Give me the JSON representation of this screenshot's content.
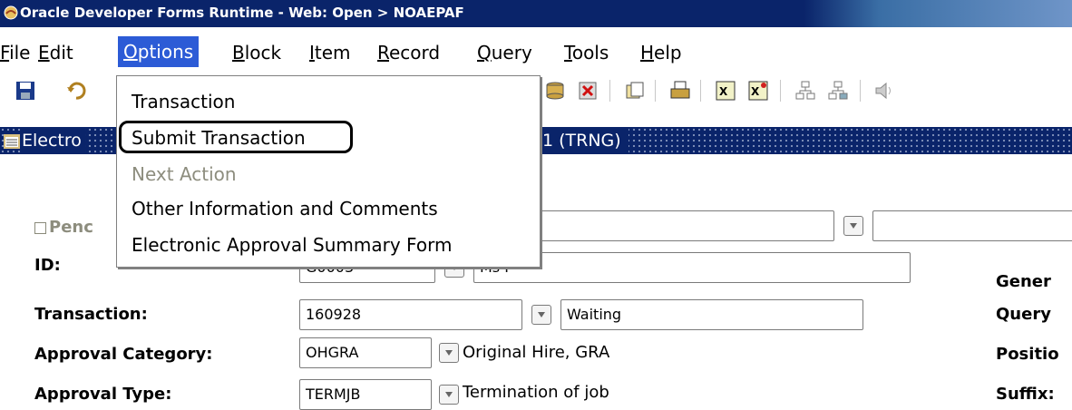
{
  "window": {
    "title": "Oracle Developer Forms Runtime - Web:  Open > NOAEPAF"
  },
  "menubar": {
    "items": [
      {
        "label": "File"
      },
      {
        "label": "Edit"
      },
      {
        "label": "Options"
      },
      {
        "label": "Block"
      },
      {
        "label": "Item"
      },
      {
        "label": "Record"
      },
      {
        "label": "Query"
      },
      {
        "label": "Tools"
      },
      {
        "label": "Help"
      }
    ],
    "active": "Options"
  },
  "options_menu": {
    "items": [
      {
        "label": "Transaction",
        "enabled": true
      },
      {
        "label": "Submit Transaction",
        "enabled": true,
        "highlighted": true
      },
      {
        "label": "Next Action",
        "enabled": false
      },
      {
        "label": "Other Information and Comments",
        "enabled": true
      },
      {
        "label": "Electronic Approval Summary Form",
        "enabled": true
      }
    ]
  },
  "toolbar": {
    "icons": [
      "save-icon",
      "rollback-icon",
      "database-icon",
      "delete-record-icon",
      "print-icon",
      "printer-icon",
      "exit-icon",
      "excel-icon",
      "chart-icon",
      "hierarchy-icon",
      "hierarchy-alt-icon",
      "speaker-icon"
    ]
  },
  "form": {
    "title_left": "Electro",
    "title_right": "1 (TRNG)",
    "pending_label": "Penc",
    "fields": {
      "id": {
        "label": "ID:",
        "value": "G0003",
        "desc": "Ms P"
      },
      "transaction": {
        "label": "Transaction:",
        "value": "160928",
        "desc": "Waiting"
      },
      "approval_category": {
        "label": "Approval Category:",
        "value": "OHGRA",
        "desc": "Original Hire, GRA"
      },
      "approval_type": {
        "label": "Approval Type:",
        "value": "TERMJB",
        "desc": "Termination of job"
      }
    },
    "right_labels": [
      "Gener",
      "Query",
      "Positio",
      "Suffix:"
    ]
  }
}
